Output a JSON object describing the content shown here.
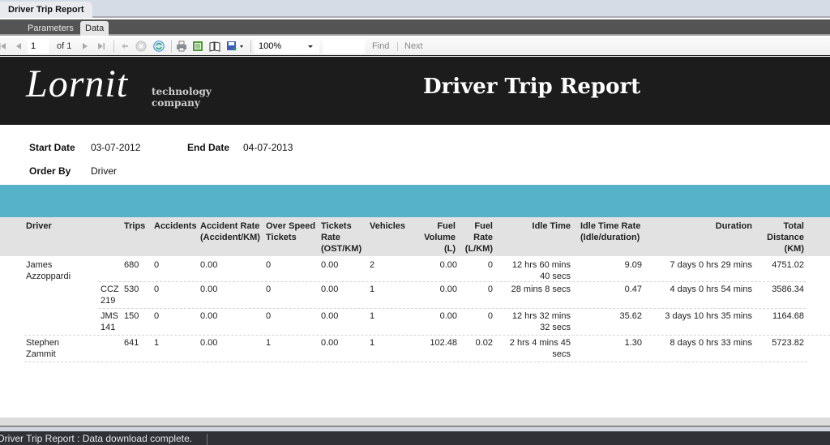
{
  "window": {
    "tab_title": "Driver Trip Report"
  },
  "view_tabs": [
    {
      "label": "Parameters",
      "active": false
    },
    {
      "label": "Data",
      "active": true
    }
  ],
  "toolbar": {
    "current_page": "1",
    "page_of": "of 1",
    "zoom": "100%",
    "find_value": "",
    "find_label": "Find",
    "next_label": "Next",
    "icons": [
      "first-page-icon",
      "prev-page-icon",
      "next-page-icon",
      "last-page-icon",
      "back-icon",
      "stop-icon",
      "refresh-icon",
      "print-icon",
      "page-layout-icon",
      "document-map-icon",
      "export-icon"
    ]
  },
  "report": {
    "logo_text": "Lornit",
    "logo_sub_line1": "technology",
    "logo_sub_line2": "company",
    "title": "Driver Trip Report",
    "params": {
      "start_date_label": "Start Date",
      "start_date": "03-07-2012",
      "end_date_label": "End Date",
      "end_date": "04-07-2013",
      "order_by_label": "Order By",
      "order_by": "Driver"
    },
    "columns": {
      "driver": "Driver",
      "trips": "Trips",
      "accidents": "Accidents",
      "accident_rate": "Accident Rate (Accident/KM)",
      "over_speed": "Over Speed Tickets",
      "tickets_rate": "Tickets Rate (OST/KM)",
      "vehicles": "Vehicles",
      "fuel_volume": "Fuel Volume (L)",
      "fuel_rate": "Fuel Rate (L/KM)",
      "idle_time": "Idle Time",
      "idle_rate": "Idle Time Rate (Idle/duration)",
      "duration": "Duration",
      "total_distance": "Total Distance (KM)"
    },
    "rows": [
      {
        "driver": "James Azzoppardi",
        "vehicle": "",
        "trips": "680",
        "accidents": "0",
        "accident_rate": "0.00",
        "over_speed": "0",
        "tickets_rate": "0.00",
        "vehicles": "2",
        "fuel_volume": "0.00",
        "fuel_rate": "0",
        "idle_time": "12 hrs 60 mins 40 secs",
        "idle_rate": "9.09",
        "duration": "7 days 0 hrs 29 mins",
        "total_distance": "4751.02"
      },
      {
        "driver": "",
        "vehicle": "CCZ 219",
        "trips": "530",
        "accidents": "0",
        "accident_rate": "0.00",
        "over_speed": "0",
        "tickets_rate": "0.00",
        "vehicles": "1",
        "fuel_volume": "0.00",
        "fuel_rate": "0",
        "idle_time": "28 mins 8 secs",
        "idle_rate": "0.47",
        "duration": "4 days 0 hrs 54 mins",
        "total_distance": "3586.34"
      },
      {
        "driver": "",
        "vehicle": "JMS 141",
        "trips": "150",
        "accidents": "0",
        "accident_rate": "0.00",
        "over_speed": "0",
        "tickets_rate": "0.00",
        "vehicles": "1",
        "fuel_volume": "0.00",
        "fuel_rate": "0",
        "idle_time": "12 hrs 32 mins 32 secs",
        "idle_rate": "35.62",
        "duration": "3 days 10 hrs 35 mins",
        "total_distance": "1164.68"
      },
      {
        "driver": "Stephen Zammit",
        "vehicle": "",
        "trips": "641",
        "accidents": "1",
        "accident_rate": "0.00",
        "over_speed": "1",
        "tickets_rate": "0.00",
        "vehicles": "1",
        "fuel_volume": "102.48",
        "fuel_rate": "0.02",
        "idle_time": "2 hrs 4 mins 45 secs",
        "idle_rate": "1.30",
        "duration": "8 days 0 hrs 33 mins",
        "total_distance": "5723.82"
      }
    ]
  },
  "status": {
    "text": "Driver Trip Report : Data download complete."
  }
}
